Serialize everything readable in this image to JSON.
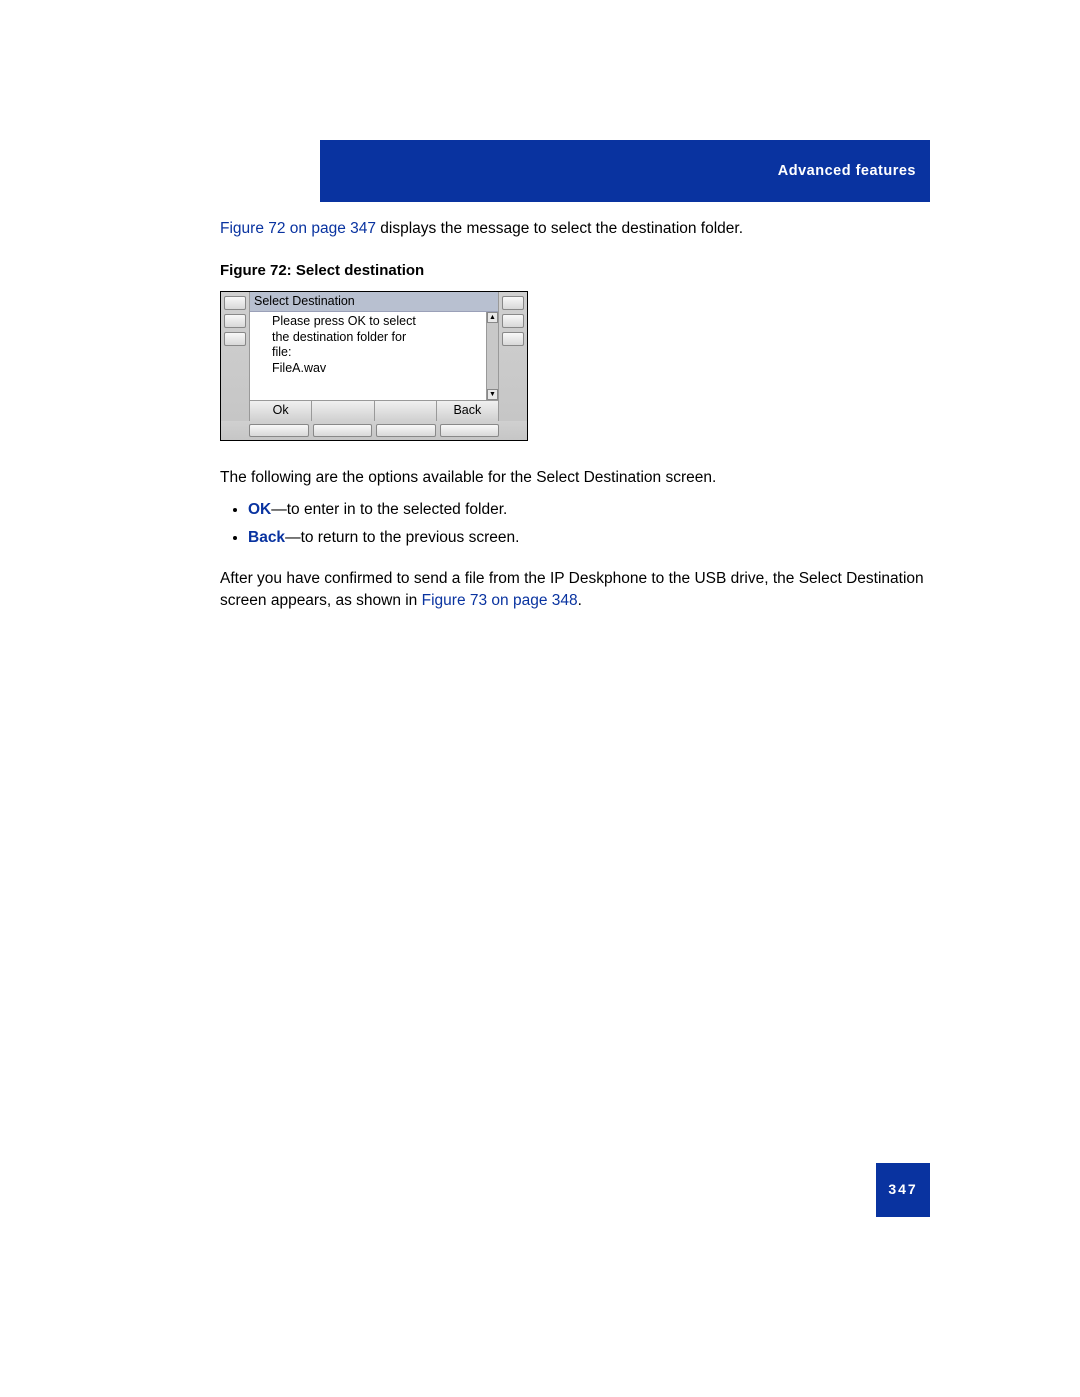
{
  "header": {
    "title": "Advanced features"
  },
  "intro": {
    "xref": "Figure 72 on page 347",
    "rest": " displays the message to select the destination folder."
  },
  "figure": {
    "caption": "Figure 72: Select destination",
    "screen_title": "Select Destination",
    "line1": "Please press OK to select",
    "line2": "the destination folder for",
    "line3": "file:",
    "line4": "FileA.wav",
    "softkeys": {
      "ok": "Ok",
      "back": "Back"
    }
  },
  "options_intro": "The following are the options available for the Select Destination screen.",
  "option_ok": {
    "label": "OK",
    "desc": "—to enter in to the selected folder."
  },
  "option_back": {
    "label": "Back",
    "desc": "—to return to the previous screen."
  },
  "after": {
    "part1": "After you have confirmed to send a file from the IP Deskphone to the USB drive, the Select Destination screen appears, as shown in ",
    "xref": "Figure 73 on page 348",
    "part2": "."
  },
  "page_number": "347"
}
